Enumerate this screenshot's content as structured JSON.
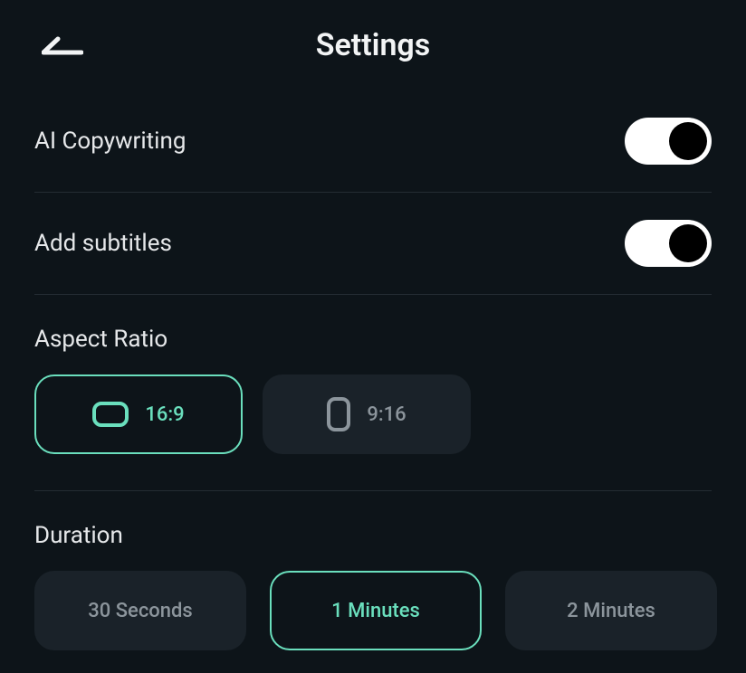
{
  "header": {
    "title": "Settings"
  },
  "toggles": {
    "ai_copywriting": {
      "label": "AI Copywriting",
      "on": true
    },
    "add_subtitles": {
      "label": "Add subtitles",
      "on": true
    }
  },
  "aspect_ratio": {
    "title": "Aspect Ratio",
    "options": [
      {
        "label": "16:9",
        "selected": true
      },
      {
        "label": "9:16",
        "selected": false
      }
    ]
  },
  "duration": {
    "title": "Duration",
    "options": [
      {
        "label": "30 Seconds",
        "selected": false
      },
      {
        "label": "1 Minutes",
        "selected": true
      },
      {
        "label": "2 Minutes",
        "selected": false
      }
    ]
  },
  "colors": {
    "accent": "#6adfbd",
    "bg": "#0d1419",
    "chip_bg": "#1a2229",
    "text": "#e6e8ea",
    "muted": "#8c959c"
  }
}
